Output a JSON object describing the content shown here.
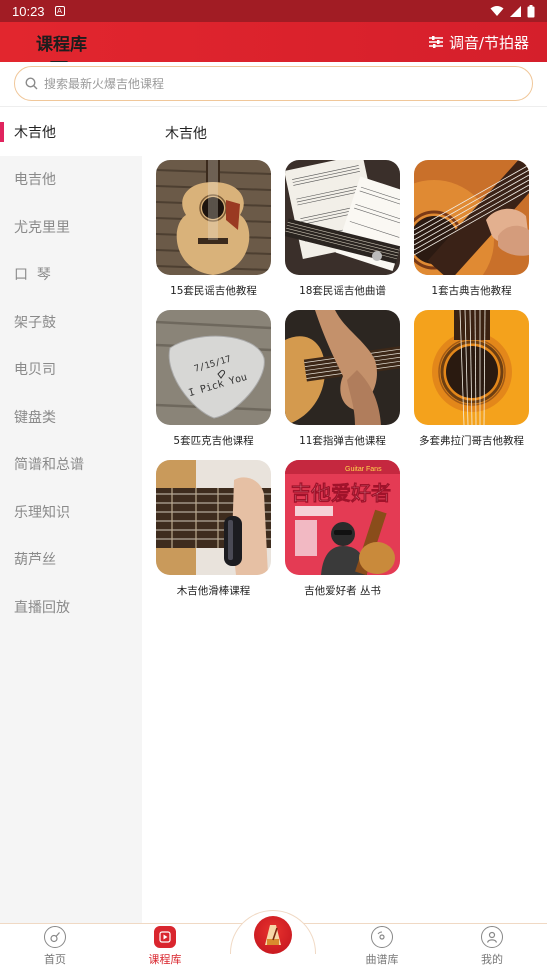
{
  "status_bar": {
    "time": "10:23",
    "sim_glyph": "A"
  },
  "header": {
    "title": "课程库",
    "tuner_label": "调音/节拍器"
  },
  "search": {
    "placeholder": "搜索最新火爆吉他课程",
    "value": ""
  },
  "sidebar": {
    "items": [
      {
        "label": "木吉他",
        "active": true
      },
      {
        "label": "电吉他",
        "active": false
      },
      {
        "label": "尤克里里",
        "active": false
      },
      {
        "label": "口  琴",
        "active": false
      },
      {
        "label": "架子鼓",
        "active": false
      },
      {
        "label": "电贝司",
        "active": false
      },
      {
        "label": "键盘类",
        "active": false
      },
      {
        "label": "简谱和总谱",
        "active": false
      },
      {
        "label": "乐理知识",
        "active": false
      },
      {
        "label": "葫芦丝",
        "active": false
      },
      {
        "label": "直播回放",
        "active": false
      }
    ]
  },
  "content": {
    "section_title": "木吉他",
    "cards": [
      {
        "label": "15套民谣吉他教程",
        "thumb": "acoustic-guitar-wood-photo"
      },
      {
        "label": "18套民谣吉他曲谱",
        "thumb": "sheet-music-photo"
      },
      {
        "label": "1套古典吉他教程",
        "thumb": "classical-guitar-strings-photo"
      },
      {
        "label": "5套匹克吉他课程",
        "thumb": "guitar-pick-photo",
        "pick_text_1": "7/15/17",
        "pick_text_2": "I Pick You"
      },
      {
        "label": "11套指弹吉他课程",
        "thumb": "fingerstyle-hand-photo"
      },
      {
        "label": "多套弗拉门哥吉他教程",
        "thumb": "flamenco-guitar-photo"
      },
      {
        "label": "木吉他滑棒课程",
        "thumb": "slide-guitar-photo"
      },
      {
        "label": "吉他爱好者 丛书",
        "thumb": "magazine-cover-photo",
        "cover_title": "吉他爱好者",
        "cover_en": "Guitar Fans"
      }
    ]
  },
  "tabbar": {
    "items": [
      {
        "label": "首页",
        "icon": "home-guitar-icon",
        "active": false
      },
      {
        "label": "课程库",
        "icon": "course-play-icon",
        "active": true
      },
      {
        "label": "",
        "icon": "metronome-icon",
        "active": false
      },
      {
        "label": "曲谱库",
        "icon": "record-disc-icon",
        "active": false
      },
      {
        "label": "我的",
        "icon": "user-icon",
        "active": false
      }
    ]
  },
  "colors": {
    "header_red": "#e2262e",
    "accent_pink": "#e0245e",
    "search_border": "#f0c79a",
    "active_tab": "#d9262e"
  }
}
